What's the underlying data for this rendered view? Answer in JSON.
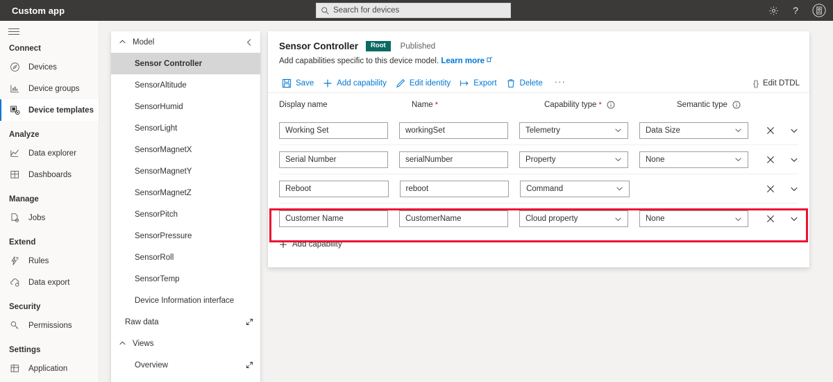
{
  "topbar": {
    "brand": "Custom app",
    "search_placeholder": "Search for devices",
    "icons": {
      "search": "search-icon",
      "settings": "gear-icon",
      "help": "question-mark-icon",
      "account": "account-badge-icon"
    }
  },
  "sidebar": {
    "menu_icon": "hamburger-menu-icon",
    "groups": [
      {
        "label": "Connect",
        "items": [
          {
            "label": "Devices",
            "icon": "devices-icon",
            "active": false
          },
          {
            "label": "Device groups",
            "icon": "device-groups-icon",
            "active": false
          },
          {
            "label": "Device templates",
            "icon": "device-templates-icon",
            "active": true
          }
        ]
      },
      {
        "label": "Analyze",
        "items": [
          {
            "label": "Data explorer",
            "icon": "chart-line-icon",
            "active": false
          },
          {
            "label": "Dashboards",
            "icon": "dashboard-grid-icon",
            "active": false
          }
        ]
      },
      {
        "label": "Manage",
        "items": [
          {
            "label": "Jobs",
            "icon": "jobs-document-icon",
            "active": false
          }
        ]
      },
      {
        "label": "Extend",
        "items": [
          {
            "label": "Rules",
            "icon": "rules-lightning-icon",
            "active": false
          },
          {
            "label": "Data export",
            "icon": "cloud-export-icon",
            "active": false
          }
        ]
      },
      {
        "label": "Security",
        "items": [
          {
            "label": "Permissions",
            "icon": "key-icon",
            "active": false
          }
        ]
      },
      {
        "label": "Settings",
        "items": [
          {
            "label": "Application",
            "icon": "application-grid-icon",
            "active": false
          }
        ]
      }
    ]
  },
  "model_panel": {
    "title": "Model",
    "collapse_icon": "chevron-left-icon",
    "expand_icon": "chevron-up-icon",
    "items": [
      {
        "label": "Sensor Controller",
        "selected": true
      },
      {
        "label": "SensorAltitude",
        "selected": false
      },
      {
        "label": "SensorHumid",
        "selected": false
      },
      {
        "label": "SensorLight",
        "selected": false
      },
      {
        "label": "SensorMagnetX",
        "selected": false
      },
      {
        "label": "SensorMagnetY",
        "selected": false
      },
      {
        "label": "SensorMagnetZ",
        "selected": false
      },
      {
        "label": "SensorPitch",
        "selected": false
      },
      {
        "label": "SensorPressure",
        "selected": false
      },
      {
        "label": "SensorRoll",
        "selected": false
      },
      {
        "label": "SensorTemp",
        "selected": false
      },
      {
        "label": "Device Information interface",
        "selected": false
      }
    ],
    "raw_data": {
      "label": "Raw data",
      "icon": "expand-diagonal-icon"
    },
    "views": {
      "label": "Views",
      "chevron": "chevron-up-icon"
    },
    "views_items": [
      {
        "label": "Overview",
        "icon": "expand-diagonal-icon"
      }
    ]
  },
  "main": {
    "title": "Sensor Controller",
    "badge": "Root",
    "status": "Published",
    "subtitle": "Add capabilities specific to this device model.",
    "learn_more": "Learn more",
    "commands": [
      {
        "label": "Save",
        "icon": "save-icon"
      },
      {
        "label": "Add capability",
        "icon": "plus-icon"
      },
      {
        "label": "Edit identity",
        "icon": "pencil-icon"
      },
      {
        "label": "Export",
        "icon": "export-arrow-icon"
      },
      {
        "label": "Delete",
        "icon": "trash-icon"
      }
    ],
    "overflow": "···",
    "edit_dtdl": {
      "label": "Edit DTDL",
      "icon": "curly-braces-icon"
    },
    "columns": [
      {
        "label": "Display name",
        "required": false,
        "info": false
      },
      {
        "label": "Name",
        "required": true,
        "info": false
      },
      {
        "label": "Capability type",
        "required": true,
        "info": true
      },
      {
        "label": "Semantic type",
        "required": false,
        "info": true
      }
    ],
    "required_marker": "*",
    "rows": [
      {
        "display_name": "Working Set",
        "name": "workingSet",
        "capability_type": "Telemetry",
        "semantic_type": "Data Size",
        "highlighted": false
      },
      {
        "display_name": "Serial Number",
        "name": "serialNumber",
        "capability_type": "Property",
        "semantic_type": "None",
        "highlighted": false
      },
      {
        "display_name": "Reboot",
        "name": "reboot",
        "capability_type": "Command",
        "semantic_type": null,
        "highlighted": false
      },
      {
        "display_name": "Customer Name",
        "name": "CustomerName",
        "capability_type": "Cloud property",
        "semantic_type": "None",
        "highlighted": true
      }
    ],
    "row_actions": {
      "remove": "close-x-icon",
      "expand": "chevron-down-icon"
    },
    "add_capability": {
      "label": "Add capability",
      "icon": "plus-icon"
    },
    "highlight_color": "#ee1133"
  }
}
